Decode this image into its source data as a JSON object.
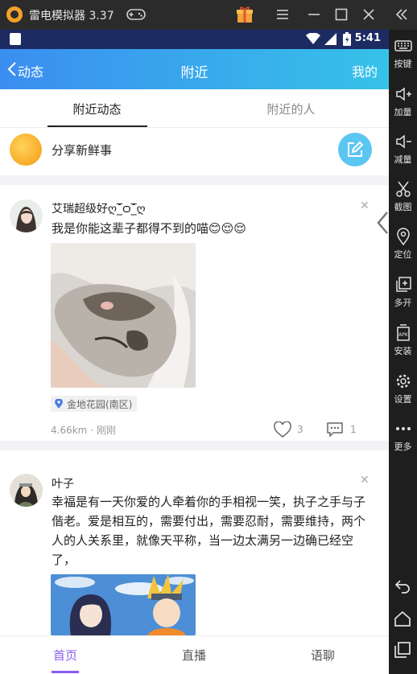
{
  "emulator": {
    "title": "雷电模拟器 3.37",
    "sidebar": [
      {
        "label": "按键",
        "icon": "keyboard-icon"
      },
      {
        "label": "加量",
        "icon": "volume-up-icon"
      },
      {
        "label": "减量",
        "icon": "volume-down-icon"
      },
      {
        "label": "截图",
        "icon": "scissors-icon"
      },
      {
        "label": "定位",
        "icon": "location-icon"
      },
      {
        "label": "多开",
        "icon": "multi-open-icon"
      },
      {
        "label": "安装",
        "icon": "apk-install-icon"
      },
      {
        "label": "设置",
        "icon": "gear-icon"
      },
      {
        "label": "更多",
        "icon": "more-icon"
      }
    ]
  },
  "status_bar": {
    "time": "5:41"
  },
  "navbar": {
    "back_label": "动态",
    "title": "附近",
    "right_label": "我的"
  },
  "tabs": [
    {
      "label": "附近动态",
      "active": true
    },
    {
      "label": "附近的人",
      "active": false
    }
  ],
  "share": {
    "prompt": "分享新鲜事"
  },
  "posts": [
    {
      "username": "艾瑞超级好ღ˘̲̅ѻ˘̲̅ღ",
      "content": "我是你能这辈子都得不到的喵😊😌😌",
      "location": "金地花园(南区)",
      "distance": "4.66km",
      "time": "刚刚",
      "likes": "3",
      "comments": "1"
    },
    {
      "username": "叶子",
      "content": "幸福是有一天你爱的人牵着你的手相视一笑，执子之手与子偕老。爱是相互的，需要付出，需要忍耐，需要维持，两个人的人关系里，就像天平称，当一边太满另一边确已经空了，"
    }
  ],
  "bottom_tabs": [
    {
      "label": "首页",
      "active": true
    },
    {
      "label": "直播",
      "active": false
    },
    {
      "label": "语聊",
      "active": false
    }
  ],
  "colors": {
    "nav_start": "#3b8ef0",
    "nav_end": "#36c2e8",
    "accent": "#8a5cf0",
    "share_button": "#5cc6f2"
  }
}
